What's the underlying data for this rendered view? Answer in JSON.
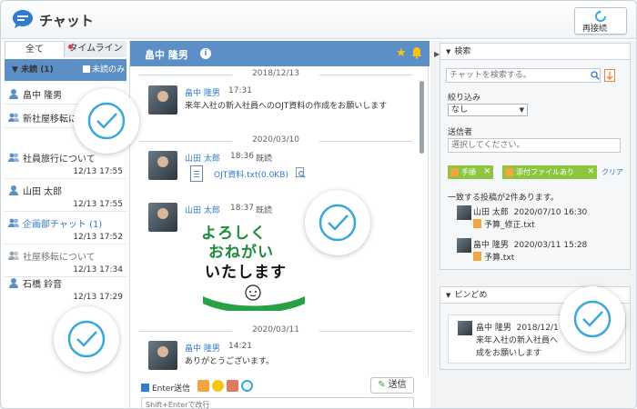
{
  "app": {
    "title": "チャット",
    "reconnect_label": "再接続"
  },
  "left": {
    "tabs": [
      {
        "label": "全て"
      },
      {
        "label": "タイムライン"
      }
    ],
    "unread_header": "未読 (1)",
    "unread_only": "未読のみ",
    "rooms": [
      {
        "name": "畠中 隆男",
        "time": "",
        "type": "user",
        "style": "normal"
      },
      {
        "name": "新社屋移転に",
        "time": "",
        "type": "group",
        "style": "normal"
      },
      {
        "name": "社員旅行について",
        "time": "12/13 17:55",
        "type": "group",
        "style": "normal"
      },
      {
        "name": "山田 太郎",
        "time": "12/13 17:55",
        "type": "user",
        "style": "normal"
      },
      {
        "name": "企画部チャット (1)",
        "time": "12/13 17:52",
        "type": "group",
        "style": "blue"
      },
      {
        "name": "社屋移転について",
        "time": "12/13 17:34",
        "type": "group",
        "style": "gray"
      },
      {
        "name": "石橋 鈴音",
        "time": "12/13 17:29",
        "type": "user",
        "style": "normal"
      }
    ]
  },
  "chat": {
    "header_name": "畠中 隆男",
    "dates": [
      "2018/12/13",
      "2020/03/10",
      "2020/03/11"
    ],
    "messages": [
      {
        "sender": "畠中 隆男",
        "time": "17:31",
        "read": "",
        "text": "来年入社の新入社員へのOJT資料の作成をお願いします"
      },
      {
        "sender": "山田 太郎",
        "time": "18:36",
        "read": "既読",
        "file": "OJT資料.txt(0.0KB)"
      },
      {
        "sender": "山田 太郎",
        "time": "18:37",
        "read": "既読",
        "sticker": [
          "よろしく",
          "おねがい",
          "いたします"
        ]
      },
      {
        "sender": "畠中 隆男",
        "time": "14:21",
        "read": "",
        "text": "ありがとうございます。"
      }
    ],
    "composer": {
      "enter_send": "Enter送信",
      "send_label": "送信",
      "placeholder": "Shift+Enterで改行"
    }
  },
  "search": {
    "header": "検索",
    "placeholder": "チャットを検索する。",
    "filter_label": "絞り込み",
    "filter_value": "なし",
    "sender_label": "送信者",
    "sender_placeholder": "選択してください。",
    "chips": [
      {
        "label": "手順"
      },
      {
        "label": "添付ファイルあり"
      }
    ],
    "clear_label": "クリア",
    "result_count": "一致する投稿が2件あります。",
    "results": [
      {
        "sender": "山田 太郎",
        "datetime": "2020/07/10 16:30",
        "file": "予算_修正.txt"
      },
      {
        "sender": "畠中 隆男",
        "datetime": "2020/03/11 15:28",
        "file": "予算.txt"
      }
    ]
  },
  "pins": {
    "header": "ピンどめ",
    "item": {
      "sender": "畠中 隆男",
      "datetime": "2018/12/1",
      "text_line1": "来年入社の新入社員へ",
      "text_line2": "成をお願いします"
    }
  },
  "colors": {
    "accent": "#5b8fc6",
    "link": "#2e7bcf",
    "chip": "#8cc63f",
    "check": "#3aa8d8"
  }
}
